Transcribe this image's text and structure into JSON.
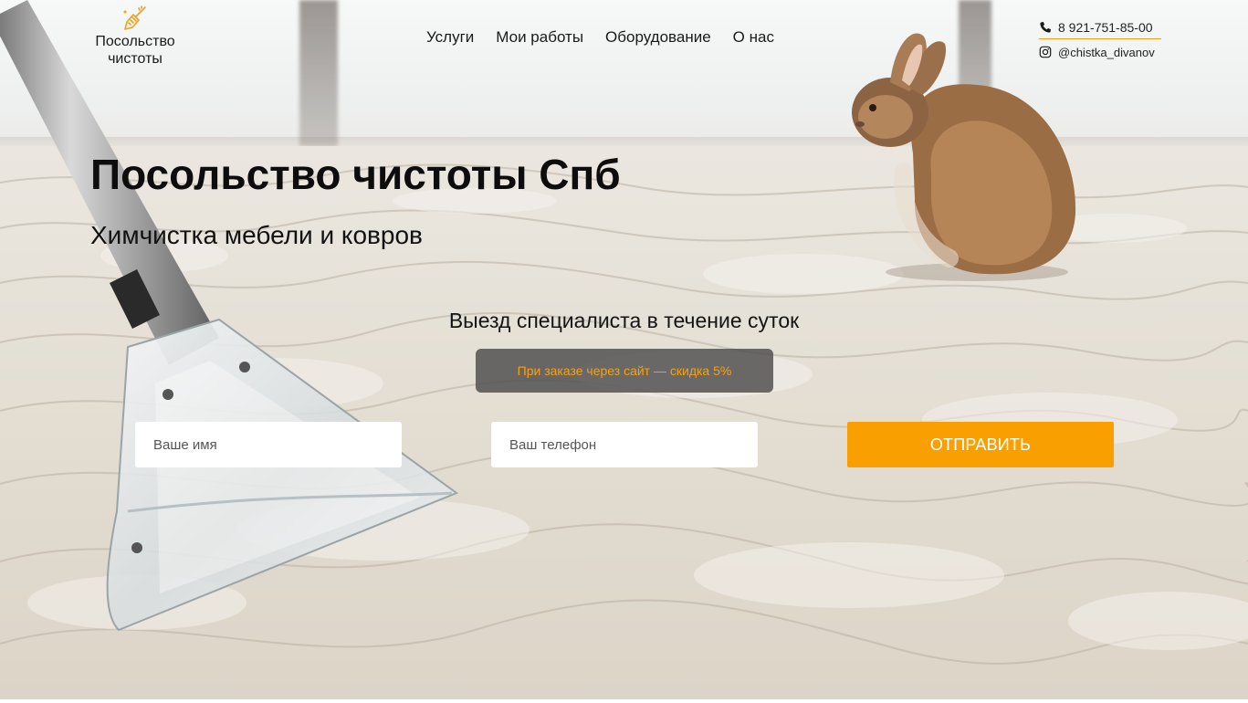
{
  "header": {
    "logo_text": "Посольство чистоты",
    "logo_icon": "broom-icon",
    "nav": [
      {
        "label": "Услуги"
      },
      {
        "label": "Мои работы"
      },
      {
        "label": "Оборудование"
      },
      {
        "label": "О нас"
      }
    ],
    "contacts": {
      "phone": "8 921-751-85-00",
      "phone_icon": "phone-icon",
      "instagram": "@chistka_divanov",
      "instagram_icon": "instagram-icon"
    }
  },
  "hero": {
    "title": "Посольство чистоты Спб",
    "subtitle": "Химчистка мебели и ковров",
    "visit_note": "Выезд специалиста в течение суток",
    "discount": "При заказе через сайт — скидка 5%"
  },
  "form": {
    "name_placeholder": "Ваше имя",
    "name_value": "",
    "phone_placeholder": "Ваш телефон",
    "phone_value": "",
    "submit_label": "ОТПРАВИТЬ"
  },
  "colors": {
    "accent": "#fa9f02",
    "badge_bg": "#4c4c4c",
    "badge_text": "#f5a213",
    "contact_underline": "#f0a117"
  }
}
